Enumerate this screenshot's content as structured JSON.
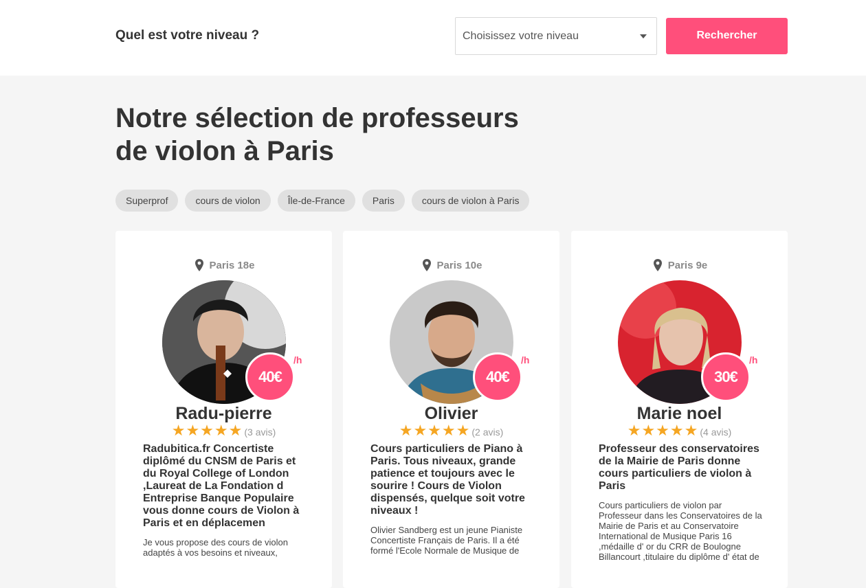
{
  "search": {
    "question": "Quel est votre niveau ?",
    "select_placeholder": "Choisissez votre niveau",
    "button_label": "Rechercher"
  },
  "page": {
    "heading_line1": "Notre sélection de professeurs",
    "heading_line2": "de violon à Paris"
  },
  "tags": [
    "Superprof",
    "cours de violon",
    "Île-de-France",
    "Paris",
    "cours de violon à Paris"
  ],
  "colors": {
    "accent": "#ff4f7b",
    "star": "#f5a623"
  },
  "cards": [
    {
      "location": "Paris 18e",
      "price": "40€",
      "per_hour": "/h",
      "name": "Radu-pierre",
      "stars": 5,
      "reviews": "(3 avis)",
      "title": "Radubitica.fr Concertiste diplômé du CNSM de Paris et du Royal College of London ,Laureat de La Fondation d Entreprise Banque Populaire vous donne cours de Violon à Paris et en déplacemen",
      "description": "Je vous propose des cours de violon adaptés à vos besoins et niveaux,"
    },
    {
      "location": "Paris 10e",
      "price": "40€",
      "per_hour": "/h",
      "name": "Olivier",
      "stars": 5,
      "reviews": "(2 avis)",
      "title": "Cours particuliers de Piano à Paris. Tous niveaux, grande patience et toujours avec le sourire ! Cours de Violon dispensés, quelque soit votre niveaux !",
      "description": "Olivier Sandberg est un jeune Pianiste Concertiste Français de Paris. Il a été formé l'Ecole Normale de Musique de"
    },
    {
      "location": "Paris 9e",
      "price": "30€",
      "per_hour": "/h",
      "name": "Marie noel",
      "stars": 5,
      "reviews": "(4 avis)",
      "title": "Professeur des conservatoires de la Mairie de Paris donne cours particuliers de violon à Paris",
      "description": "Cours particuliers de violon par Professeur dans les Conservatoires de la Mairie de Paris et au Conservatoire International de Musique Paris 16 ,médaille d' or du CRR de Boulogne Billancourt ,titulaire du diplôme d' état de"
    }
  ]
}
